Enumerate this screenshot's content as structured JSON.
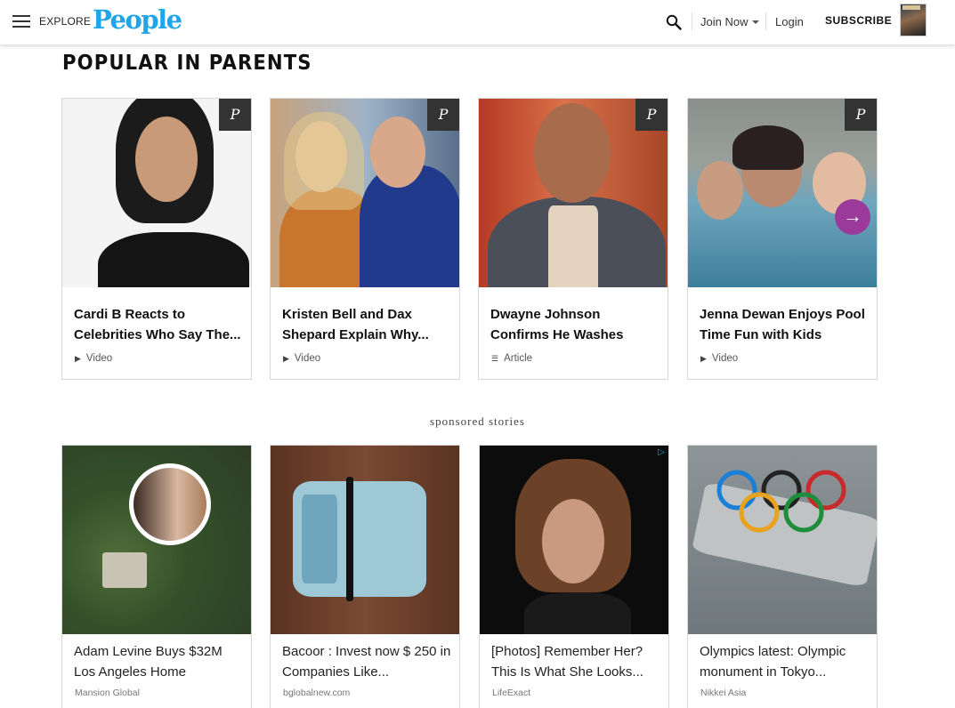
{
  "header": {
    "explore_label": "EXPLORE",
    "logo_text": "People",
    "join_label": "Join Now",
    "login_label": "Login",
    "subscribe_label": "SUBSCRIBE",
    "icons": [
      "hamburger-icon",
      "search-icon",
      "chevron-down-icon"
    ],
    "brand_color": "#1fa5e8"
  },
  "section": {
    "title": "POPULAR IN PARENTS"
  },
  "popular": [
    {
      "title": "Cardi B Reacts to Celebrities Who Say The...",
      "type": "Video",
      "type_icon": "play-icon"
    },
    {
      "title": "Kristen Bell and Dax Shepard Explain Why...",
      "type": "Video",
      "type_icon": "play-icon"
    },
    {
      "title": "Dwayne Johnson Confirms He Washes Himself Thre...",
      "type": "Article",
      "type_icon": "article-lines-icon"
    },
    {
      "title": "Jenna Dewan Enjoys Pool Time Fun with Kids Everl...",
      "type": "Video",
      "type_icon": "play-icon"
    }
  ],
  "pin_glyph": "P",
  "next_arrow_glyph": "→",
  "sponsored_label": "sponsored stories",
  "sponsored": [
    {
      "title": "Adam Levine Buys $32M Los Angeles Home",
      "source": "Mansion Global"
    },
    {
      "title": "Bacoor : Invest now $ 250 in Companies Like...",
      "source": "bglobalnew.com"
    },
    {
      "title": "[Photos] Remember Her? This Is What She Looks...",
      "source": "LifeExact"
    },
    {
      "title": "Olympics latest: Olympic monument in Tokyo...",
      "source": "Nikkei Asia"
    }
  ],
  "accent_color": "#9b3a9a"
}
